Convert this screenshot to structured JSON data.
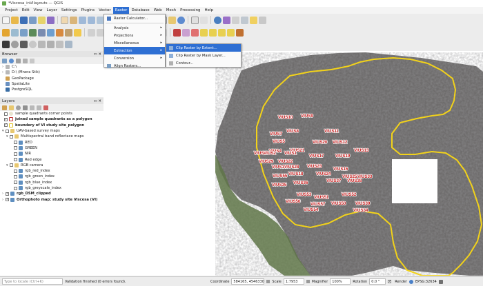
{
  "window": {
    "title": "*Viscosa_inVIlayouts — QGIS"
  },
  "menubar": [
    "Project",
    "Edit",
    "View",
    "Layer",
    "Settings",
    "Plugins",
    "Vector",
    "Raster",
    "Database",
    "Web",
    "Mesh",
    "Processing",
    "Help"
  ],
  "raster_menu": {
    "items": [
      {
        "label": "Raster Calculator...",
        "arrow": ""
      },
      {
        "label": "Analysis",
        "arrow": "▸"
      },
      {
        "label": "Projections",
        "arrow": "▸"
      },
      {
        "label": "Miscellaneous",
        "arrow": "▸"
      },
      {
        "label": "Extraction",
        "arrow": "▸"
      },
      {
        "label": "Conversion",
        "arrow": "▸"
      },
      {
        "label": "Align Rasters...",
        "arrow": ""
      }
    ]
  },
  "extraction_submenu": {
    "items": [
      "Clip Raster by Extent...",
      "Clip Raster by Mask Layer...",
      "Contour..."
    ]
  },
  "browser": {
    "title": "Browser",
    "items": [
      "C:\\",
      "D:\\ (Mnera Stik)",
      "GeoPackage",
      "SpatiaLite",
      "PostgreSQL"
    ]
  },
  "layers": {
    "title": "Layers",
    "items": [
      {
        "label": "sample quadrants corner points",
        "bold": false
      },
      {
        "label": "joined sample quadrants as a polygon",
        "bold": true
      },
      {
        "label": "boundery of VI study site_polygon",
        "bold": true
      },
      {
        "label": "UAV-based survey maps",
        "bold": false
      },
      {
        "label": "Multispectral band reflectace maps",
        "bold": false
      },
      {
        "label": "RED",
        "bold": false
      },
      {
        "label": "GREEN",
        "bold": false
      },
      {
        "label": "NIR",
        "bold": false
      },
      {
        "label": "Red edge",
        "bold": false
      },
      {
        "label": "RGB camera",
        "bold": false
      },
      {
        "label": "rgb_red_index",
        "bold": false
      },
      {
        "label": "rgb_green_index",
        "bold": false
      },
      {
        "label": "rgb_blue_index",
        "bold": false
      },
      {
        "label": "rgb_greyscale_index",
        "bold": false
      },
      {
        "label": "rgb_DSM_clipped",
        "bold": true
      },
      {
        "label": "Orthophoto map: study site Viscosa (VI)",
        "bold": true
      }
    ]
  },
  "map_labels": [
    "VIUS10",
    "VIUS9",
    "VIUS7",
    "VIUS8",
    "VIUS11",
    "VIUS5",
    "VIUS20",
    "VIUS12",
    "VIUS4",
    "VIUS21",
    "VIUS3",
    "VIUS2",
    "VIUS1",
    "VIUS29",
    "VIUS22",
    "VIUS17",
    "VIUS19",
    "VIUS13",
    "VIUS14",
    "VIUS28",
    "VIUS23",
    "VIUS16",
    "VIUS55",
    "VIUS18",
    "VIUS24",
    "VIUS25",
    "VIUS33",
    "VIUS35",
    "VIUS36",
    "VIUS37",
    "VIUS38",
    "VIUS53",
    "VIUS51",
    "VIUS52",
    "VIUS56",
    "VIUS57",
    "VIUS54",
    "VIUS50",
    "VIUS39",
    "VIUS34"
  ],
  "status": {
    "locate_placeholder": "Type to locate (Ctrl+K)",
    "message": "Validation finished (0 errors found).",
    "coordinate_label": "Coordinate",
    "coordinate": "584165, 4546330",
    "scale_label": "Scale",
    "scale": "1:7953",
    "magnifier_label": "Magnifier",
    "magnifier": "100%",
    "rotation_label": "Rotation",
    "rotation": "0.0 °",
    "render_label": "Render",
    "crs": "EPSG:32634"
  }
}
